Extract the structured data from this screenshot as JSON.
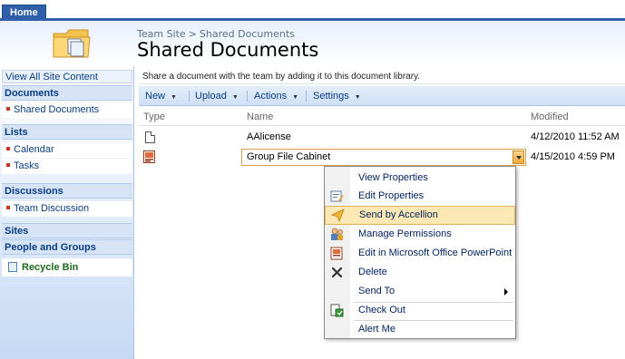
{
  "top": {
    "home_tab": "Home"
  },
  "title": {
    "breadcrumb": [
      "Team Site",
      "Shared Documents"
    ],
    "breadcrumb_sep": ">",
    "page_title": "Shared Documents"
  },
  "nav": {
    "view_all": "View All Site Content",
    "documents_head": "Documents",
    "shared_documents": "Shared Documents",
    "lists_head": "Lists",
    "calendar": "Calendar",
    "tasks": "Tasks",
    "discussions_head": "Discussions",
    "team_discussion": "Team Discussion",
    "sites_head": "Sites",
    "people_head": "People and Groups",
    "recycle_bin": "Recycle Bin"
  },
  "main": {
    "description": "Share a document with the team by adding it to this document library.",
    "toolbar": {
      "new": "New",
      "upload": "Upload",
      "actions": "Actions",
      "settings": "Settings"
    },
    "columns": {
      "type": "Type",
      "name": "Name",
      "modified": "Modified"
    },
    "rows": [
      {
        "name": "AAlicense",
        "modified": "4/12/2010 11:52 AM",
        "icon": "document-icon"
      },
      {
        "name": "Group File Cabinet",
        "modified": "4/15/2010 4:59 PM",
        "icon": "powerpoint-icon"
      }
    ]
  },
  "menu": {
    "items": [
      {
        "label": "View Properties"
      },
      {
        "label": "Edit Properties",
        "icon": "edit-properties-icon"
      },
      {
        "label": "Send by Accellion",
        "icon": "accellion-icon",
        "highlighted": true
      },
      {
        "label": "Manage Permissions",
        "icon": "permissions-icon"
      },
      {
        "label": "Edit in Microsoft Office PowerPoint",
        "icon": "powerpoint-icon"
      },
      {
        "label": "Delete",
        "icon": "delete-icon"
      },
      {
        "label": "Send To",
        "submenu": true
      },
      {
        "label": "Check Out",
        "icon": "check-out-icon"
      },
      {
        "label": "Alert Me"
      }
    ]
  },
  "colors": {
    "accent": "#2f5fa8",
    "nav_text": "#0a3d82",
    "highlight": "#fbe8b5",
    "recycle": "#1b6a1b"
  }
}
